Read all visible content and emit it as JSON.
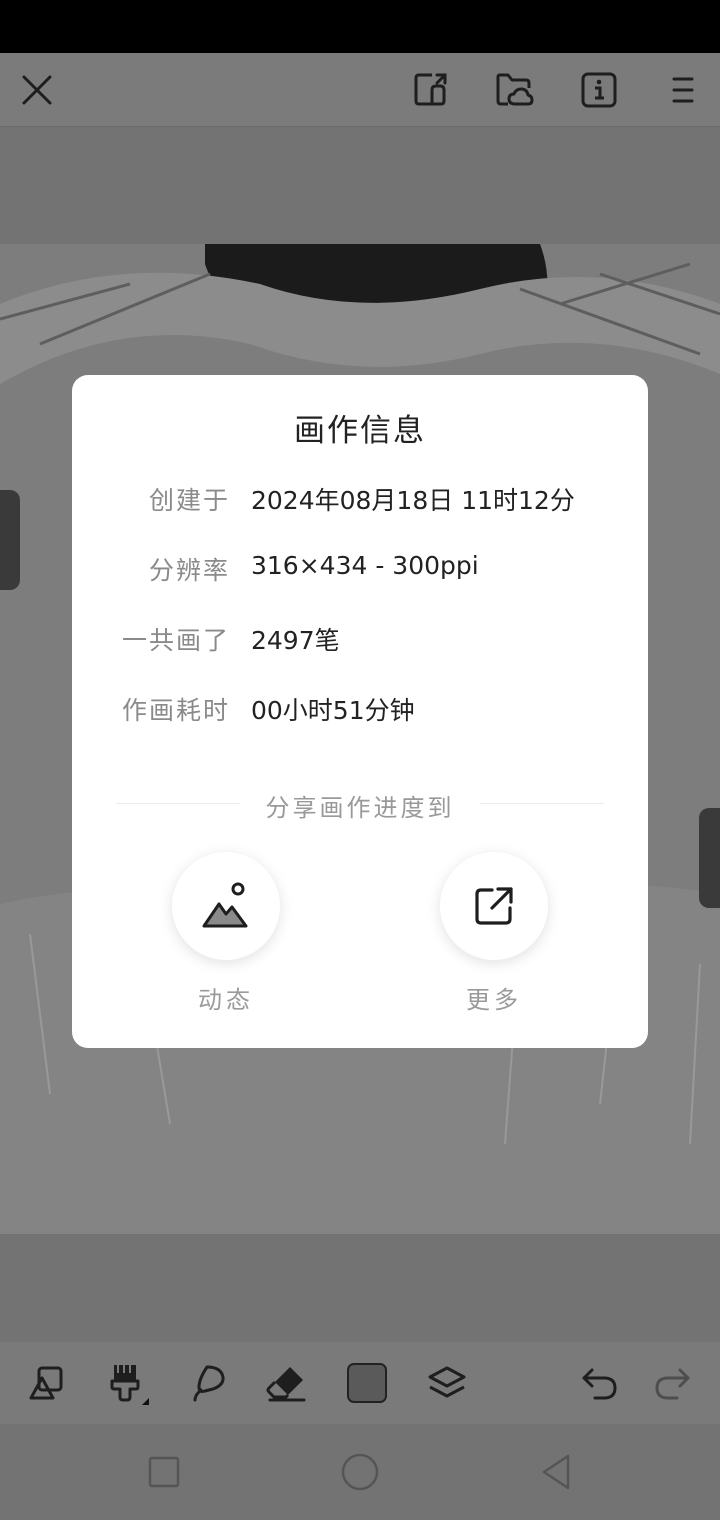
{
  "toolbar": {
    "icons": [
      "close-icon",
      "share-sticker-icon",
      "cloud-folder-icon",
      "info-icon",
      "menu-icon"
    ]
  },
  "dialog": {
    "title": "画作信息",
    "rows": [
      {
        "label": "创建于",
        "value": "2024年08月18日 11时12分"
      },
      {
        "label": "分辨率",
        "value": "316×434 - 300ppi"
      },
      {
        "label": "一共画了",
        "value": "2497笔"
      },
      {
        "label": "作画耗时",
        "value": "00小时51分钟"
      }
    ],
    "share_title": "分享画作进度到",
    "share_options": [
      {
        "label": "动态",
        "icon": "landscape-image-icon"
      },
      {
        "label": "更多",
        "icon": "external-link-icon"
      }
    ]
  },
  "bottom_toolbar": {
    "tools": [
      "shapes-icon",
      "brush-icon",
      "lasso-icon",
      "eraser-icon",
      "color-swatch",
      "layers-icon",
      "undo-icon",
      "redo-icon"
    ],
    "swatch_color": "#5a5a5a"
  },
  "colors": {
    "overlay": "#6f6f6f",
    "dialog_bg": "#ffffff",
    "label_gray": "#8a8a8a",
    "value_text": "#222222"
  }
}
